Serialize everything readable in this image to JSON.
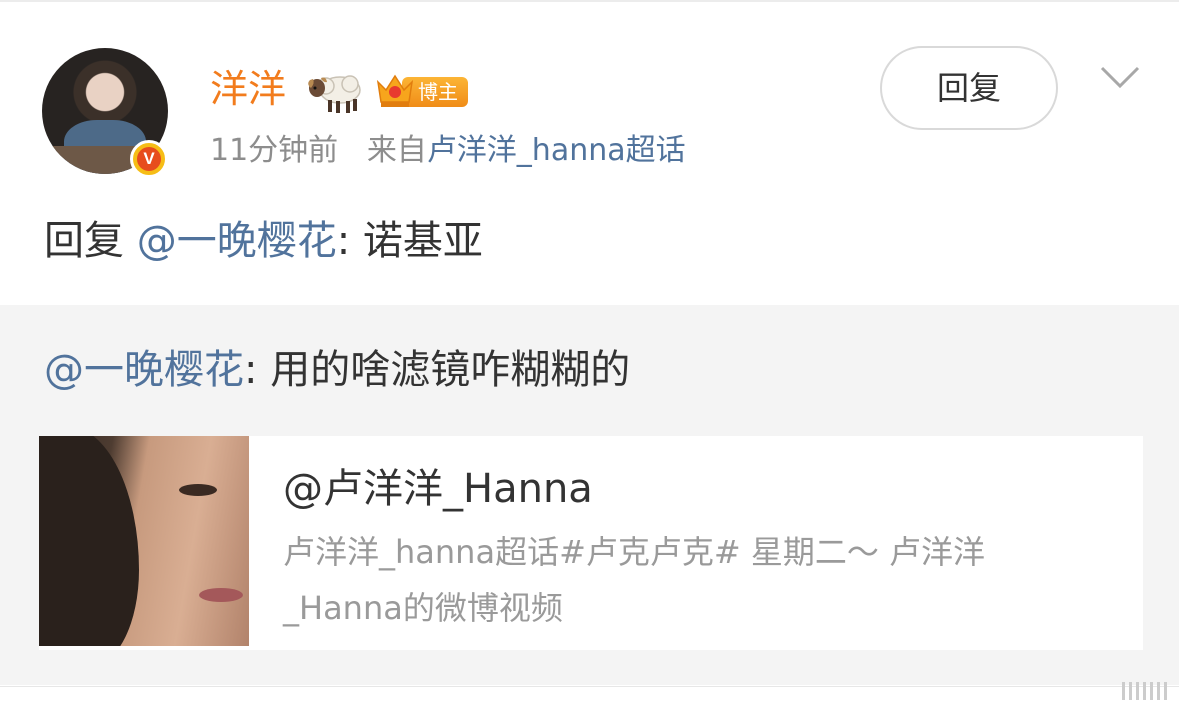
{
  "post": {
    "username": "洋洋",
    "badge_label": "博主",
    "verified_mark": "V",
    "time": "11分钟前",
    "source_prefix": "来自",
    "source_name": "卢洋洋_hanna超话",
    "reply_button": "回复",
    "text_prefix": "回复 ",
    "mention": "@一晚樱花",
    "text_suffix": ": 诺基亚"
  },
  "repost": {
    "mention": "@一晚樱花",
    "text": ": 用的啥滤镜咋糊糊的",
    "card": {
      "title": "@卢洋洋_Hanna",
      "description": "卢洋洋_hanna超话#卢克卢克# 星期二～ 卢洋洋_Hanna的微博视频"
    }
  },
  "icons": {
    "sheep": "sheep-emoji-icon",
    "crown": "crown-icon",
    "more": "chevron-down-icon"
  },
  "colors": {
    "username": "#f27c1d",
    "link": "#51739c",
    "meta": "#8d8d8d",
    "repost_bg": "#f4f4f4"
  }
}
